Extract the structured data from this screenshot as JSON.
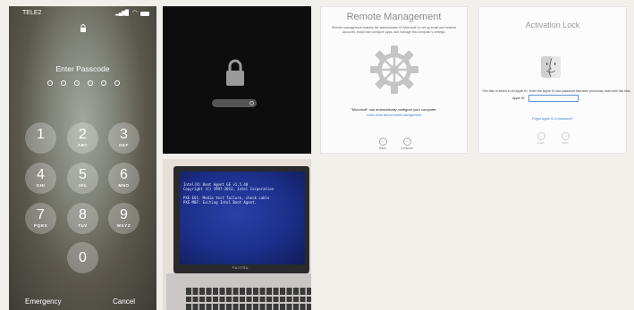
{
  "phone": {
    "carrier": "TELE2",
    "prompt": "Enter Passcode",
    "keys": [
      {
        "digit": "1",
        "letters": ""
      },
      {
        "digit": "2",
        "letters": "ABC"
      },
      {
        "digit": "3",
        "letters": "DEF"
      },
      {
        "digit": "4",
        "letters": "GHI"
      },
      {
        "digit": "5",
        "letters": "JKL"
      },
      {
        "digit": "6",
        "letters": "MNO"
      },
      {
        "digit": "7",
        "letters": "PQRS"
      },
      {
        "digit": "8",
        "letters": "TUV"
      },
      {
        "digit": "9",
        "letters": "WXYZ"
      },
      {
        "digit": "0",
        "letters": ""
      }
    ],
    "emergency": "Emergency",
    "cancel": "Cancel"
  },
  "mac_lock": {},
  "laptop": {
    "screen_lines": "Intel(R) Boot Agent GE v1.5.40\nCopyright (C) 1997-2013, Intel Corporation\n\nPXE-E61: Media test failure, check cable\nPXE-M0F: Exiting Intel Boot Agent.",
    "brand": "FUJITSU"
  },
  "remote_management": {
    "title": "Remote Management",
    "description": "Remote management enables the administrator of \"Microsoft\" to set up email and network accounts, install and configure apps, and manage this computer's settings.",
    "main_text": "\"Microsoft\" can automatically configure your computer.",
    "link": "Learn more about remote management",
    "back": "Back",
    "continue": "Continue"
  },
  "activation_lock": {
    "title": "Activation Lock",
    "description": "This Mac is linked to an Apple ID. Enter the Apple ID and password that were previously used with this Mac.",
    "apple_id_label": "Apple ID",
    "forgot": "Forgot Apple ID or password?",
    "back": "Back",
    "next": "Next"
  }
}
